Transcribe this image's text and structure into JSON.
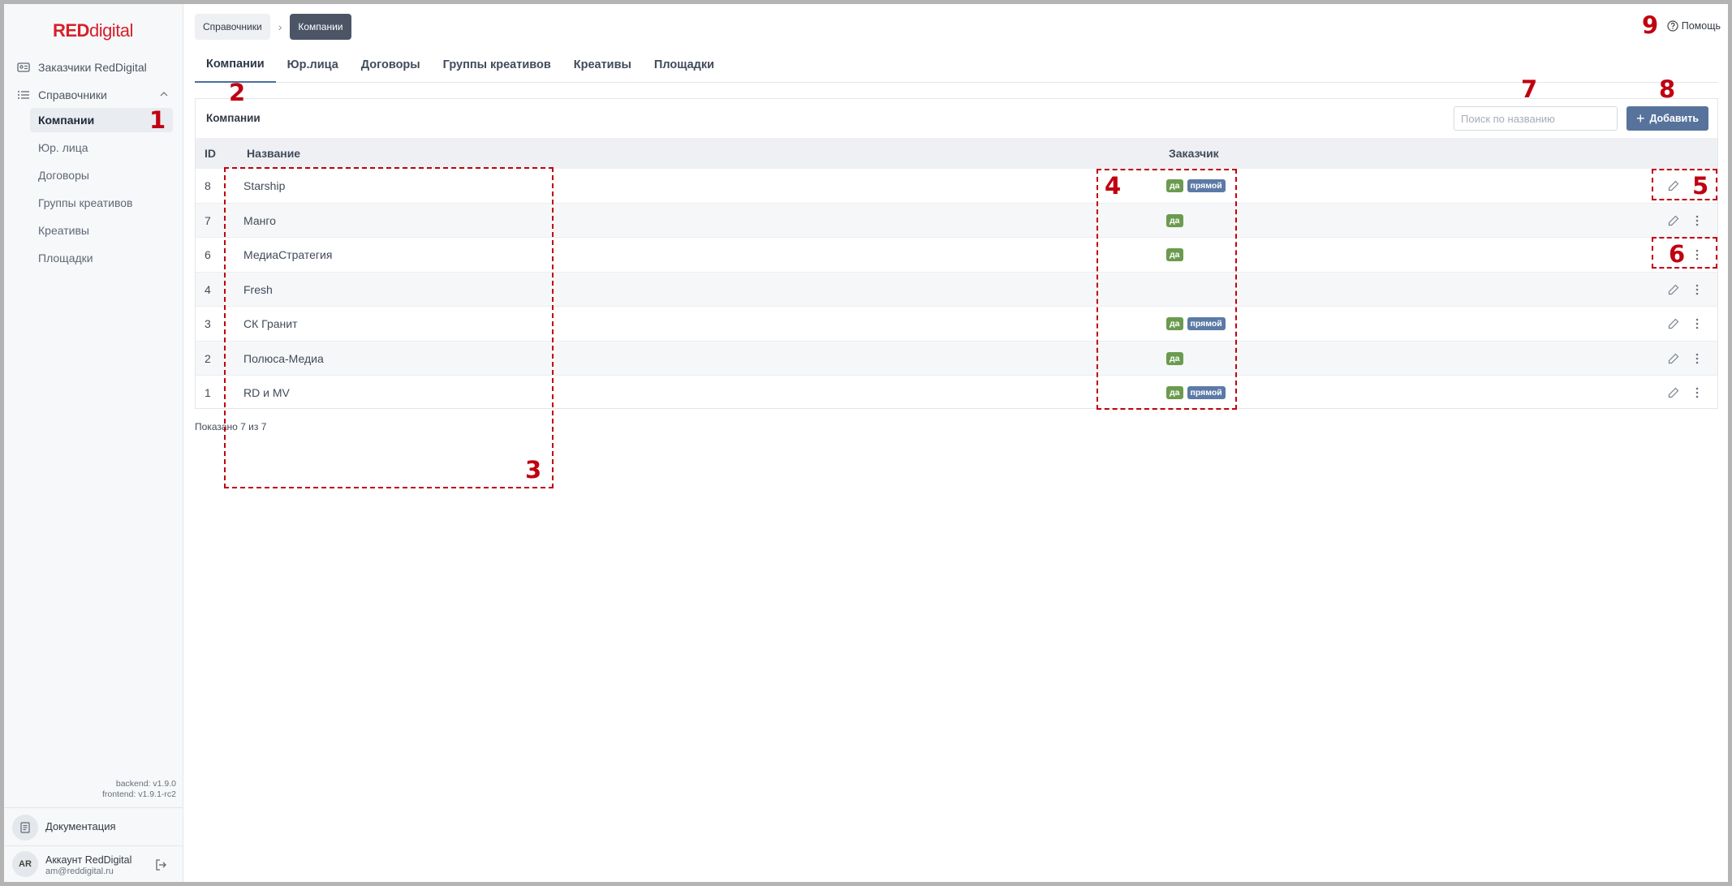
{
  "logo": {
    "red": "RED",
    "rest": "digital"
  },
  "sidebar": {
    "top_items": [
      {
        "label": "Заказчики RedDigital",
        "icon": "id-card-icon"
      },
      {
        "label": "Справочники",
        "icon": "list-icon"
      }
    ],
    "sub_items": [
      {
        "label": "Компании",
        "active": true
      },
      {
        "label": "Юр. лица"
      },
      {
        "label": "Договоры"
      },
      {
        "label": "Группы креативов"
      },
      {
        "label": "Креативы"
      },
      {
        "label": "Площадки"
      }
    ],
    "versions": {
      "backend": "backend: v1.9.0",
      "frontend": "frontend: v1.9.1-rc2"
    },
    "documentation": "Документация",
    "account": {
      "initials": "AR",
      "name": "Аккаунт RedDigital",
      "email": "am@reddigital.ru"
    }
  },
  "breadcrumb": {
    "parent": "Справочники",
    "current": "Компании"
  },
  "help": "Помощь",
  "tabs": [
    "Компании",
    "Юр.лица",
    "Договоры",
    "Группы креативов",
    "Креативы",
    "Площадки"
  ],
  "card": {
    "title": "Компании",
    "search_placeholder": "Поиск по названию",
    "add_label": "Добавить",
    "columns": {
      "id": "ID",
      "name": "Название",
      "customer": "Заказчик"
    },
    "rows": [
      {
        "id": "8",
        "name": "Starship",
        "yes": "да",
        "direct": "прямой"
      },
      {
        "id": "7",
        "name": "Манго",
        "yes": "да",
        "direct": ""
      },
      {
        "id": "6",
        "name": "МедиаСтратегия",
        "yes": "да",
        "direct": ""
      },
      {
        "id": "4",
        "name": "Fresh",
        "yes": "",
        "direct": ""
      },
      {
        "id": "3",
        "name": "СК Гранит",
        "yes": "да",
        "direct": "прямой"
      },
      {
        "id": "2",
        "name": "Полюса-Медиа",
        "yes": "да",
        "direct": ""
      },
      {
        "id": "1",
        "name": "RD и MV",
        "yes": "да",
        "direct": "прямой"
      }
    ],
    "shown": "Показано 7 из 7"
  },
  "annotations": [
    "1",
    "2",
    "3",
    "4",
    "5",
    "6",
    "7",
    "8",
    "9"
  ],
  "colors": {
    "brand": "#d6202c",
    "primary_button": "#57739b",
    "badge_yes": "#6b9b4f",
    "badge_direct": "#5b7aa6",
    "annotation": "#c00010"
  }
}
